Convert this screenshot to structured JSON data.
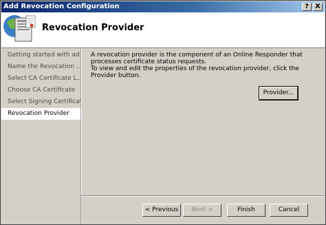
{
  "window": {
    "title": "Add Revocation Configuration",
    "help_button": "?",
    "close_button": "X"
  },
  "header": {
    "title": "Revocation Provider",
    "icon": "certificate-server-icon"
  },
  "sidebar": {
    "items": [
      {
        "label": "Getting started with ad..."
      },
      {
        "label": "Name the Revocation ..."
      },
      {
        "label": "Select CA Certificate L..."
      },
      {
        "label": "Choose CA Certificate"
      },
      {
        "label": "Select Signing Certificate"
      },
      {
        "label": "Revocation Provider",
        "active": true
      }
    ]
  },
  "main": {
    "description_line1": "A revocation provider is the component of an Online Responder that processes certificate status requests.",
    "description_line2": "To view and edit the properties of the revocation provider, click the Provider button.",
    "provider_button": "Provider..."
  },
  "footer": {
    "previous_button": "< Previous",
    "next_button": "Next >",
    "finish_button": "Finish",
    "cancel_button": "Cancel"
  }
}
